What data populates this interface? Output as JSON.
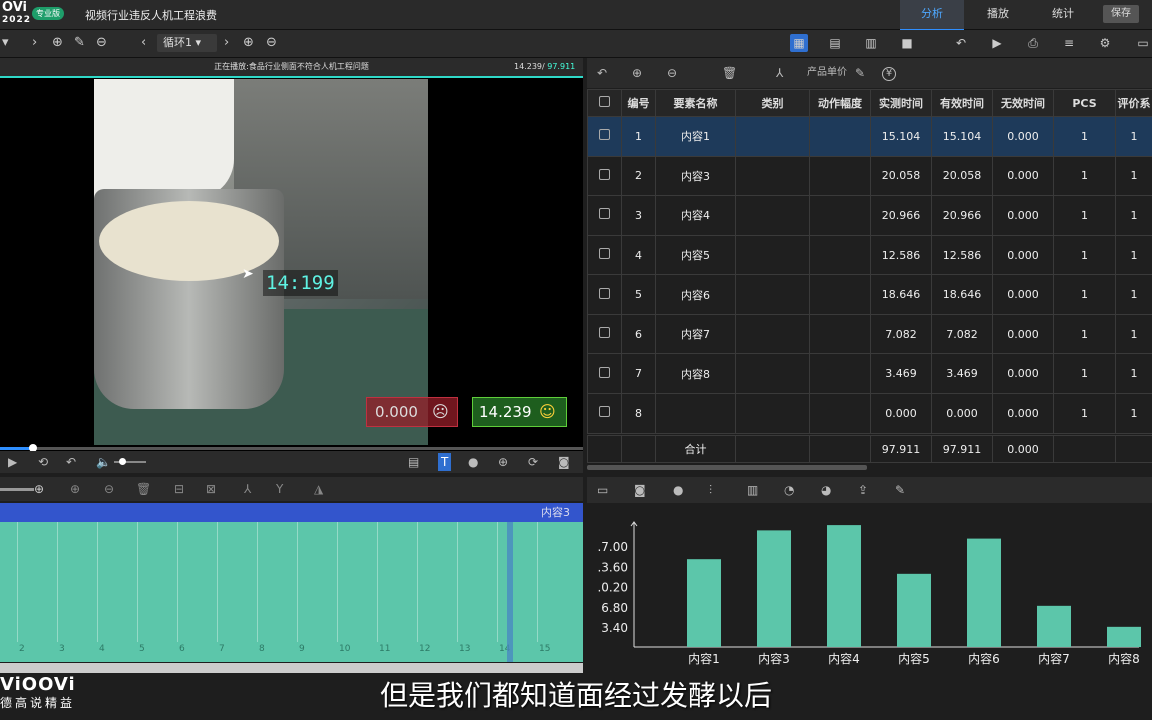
{
  "app": {
    "logo": "OVi",
    "logo_year": "2022",
    "edition_badge": "专业版",
    "title": "视频行业违反人机工程浪费",
    "nav": {
      "analysis": "分析",
      "play": "播放",
      "stats": "统计"
    },
    "save_label": "保存"
  },
  "toolbar": {
    "loop_select": "循环1"
  },
  "video": {
    "now_playing": "正在播放:食品行业侧面不符合人机工程问题",
    "time_current": "14.239",
    "time_total": "97.911",
    "overlay_timer": "14:199",
    "ineffective_value": "0.000",
    "effective_value": "14.239",
    "progress_fraction": 0.056
  },
  "timeline": {
    "current_label": "内容3",
    "ticks": [
      "2",
      "3",
      "4",
      "5",
      "6",
      "7",
      "8",
      "9",
      "10",
      "11",
      "12",
      "13",
      "14",
      "15"
    ]
  },
  "table": {
    "unit_price_label": "产品单价",
    "currency_icon": "¥",
    "headers": [
      "编号",
      "要素名称",
      "类别",
      "动作幅度",
      "实测时间",
      "有效时间",
      "无效时间",
      "PCS",
      "评价系"
    ],
    "rows": [
      {
        "id": "1",
        "name": "内容1",
        "cat": "",
        "amp": "",
        "measured": "15.104",
        "effective": "15.104",
        "ineffective": "0.000",
        "pcs": "1",
        "eval": "1"
      },
      {
        "id": "2",
        "name": "内容3",
        "cat": "",
        "amp": "",
        "measured": "20.058",
        "effective": "20.058",
        "ineffective": "0.000",
        "pcs": "1",
        "eval": "1"
      },
      {
        "id": "3",
        "name": "内容4",
        "cat": "",
        "amp": "",
        "measured": "20.966",
        "effective": "20.966",
        "ineffective": "0.000",
        "pcs": "1",
        "eval": "1"
      },
      {
        "id": "4",
        "name": "内容5",
        "cat": "",
        "amp": "",
        "measured": "12.586",
        "effective": "12.586",
        "ineffective": "0.000",
        "pcs": "1",
        "eval": "1"
      },
      {
        "id": "5",
        "name": "内容6",
        "cat": "",
        "amp": "",
        "measured": "18.646",
        "effective": "18.646",
        "ineffective": "0.000",
        "pcs": "1",
        "eval": "1"
      },
      {
        "id": "6",
        "name": "内容7",
        "cat": "",
        "amp": "",
        "measured": "7.082",
        "effective": "7.082",
        "ineffective": "0.000",
        "pcs": "1",
        "eval": "1"
      },
      {
        "id": "7",
        "name": "内容8",
        "cat": "",
        "amp": "",
        "measured": "3.469",
        "effective": "3.469",
        "ineffective": "0.000",
        "pcs": "1",
        "eval": "1"
      },
      {
        "id": "8",
        "name": "",
        "cat": "",
        "amp": "",
        "measured": "0.000",
        "effective": "0.000",
        "ineffective": "0.000",
        "pcs": "1",
        "eval": "1"
      }
    ],
    "total": {
      "label": "合计",
      "measured": "97.911",
      "effective": "97.911",
      "ineffective": "0.000"
    }
  },
  "chart_data": {
    "type": "bar",
    "categories": [
      "内容1",
      "内容3",
      "内容4",
      "内容5",
      "内容6",
      "内容7",
      "内容8"
    ],
    "values": [
      15.104,
      20.058,
      20.966,
      12.586,
      18.646,
      7.082,
      3.469
    ],
    "ytick_labels": [
      ".7.00",
      ".3.60",
      ".0.20",
      "6.80",
      "3.40"
    ],
    "bar_color": "#5cc6aa"
  },
  "branding": {
    "name": "ViOOVi",
    "slogan": "德高说精益"
  },
  "subtitle": "但是我们都知道面经过发酵以后",
  "colors": {
    "accent": "#2f8fff",
    "teal": "#5cc6aa",
    "highlight": "#2fd9c8"
  }
}
